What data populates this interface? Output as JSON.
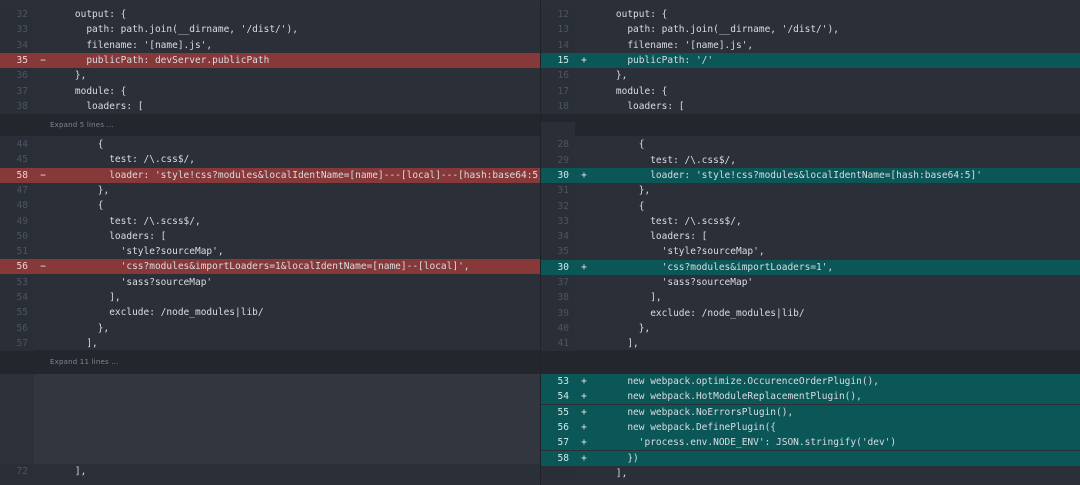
{
  "expand_labels": [
    "Expand 5 lines ...",
    "Expand 11 lines ..."
  ],
  "colors": {
    "deleted": "#873838",
    "added": "#0b5757",
    "background": "#2b2f38"
  },
  "left": {
    "block1": [
      {
        "ln": "32",
        "mk": "",
        "type": "ctx",
        "code": "    output: {"
      },
      {
        "ln": "33",
        "mk": "",
        "type": "ctx",
        "code": "      path: path.join(__dirname, '/dist/'),"
      },
      {
        "ln": "34",
        "mk": "",
        "type": "ctx",
        "code": "      filename: '[name].js',"
      },
      {
        "ln": "35",
        "mk": "−",
        "type": "del",
        "code": "      publicPath: devServer.publicPath"
      },
      {
        "ln": "36",
        "mk": "",
        "type": "ctx",
        "code": "    },"
      },
      {
        "ln": "37",
        "mk": "",
        "type": "ctx",
        "code": "    module: {"
      },
      {
        "ln": "38",
        "mk": "",
        "type": "ctx",
        "code": "      loaders: ["
      }
    ],
    "block2": [
      {
        "ln": "44",
        "mk": "",
        "type": "ctx",
        "code": "        {"
      },
      {
        "ln": "45",
        "mk": "",
        "type": "ctx",
        "code": "          test: /\\.css$/,"
      },
      {
        "ln": "58",
        "mk": "−",
        "type": "del",
        "code": "          loader: 'style!css?modules&localIdentName=[name]---[local]---[hash:base64:5]'"
      },
      {
        "ln": "47",
        "mk": "",
        "type": "ctx",
        "code": "        },"
      },
      {
        "ln": "48",
        "mk": "",
        "type": "ctx",
        "code": "        {"
      },
      {
        "ln": "49",
        "mk": "",
        "type": "ctx",
        "code": "          test: /\\.scss$/,"
      },
      {
        "ln": "50",
        "mk": "",
        "type": "ctx",
        "code": "          loaders: ["
      },
      {
        "ln": "51",
        "mk": "",
        "type": "ctx",
        "code": "            'style?sourceMap',"
      },
      {
        "ln": "56",
        "mk": "−",
        "type": "del",
        "code": "            'css?modules&importLoaders=1&localIdentName=[name]--[local]',"
      },
      {
        "ln": "53",
        "mk": "",
        "type": "ctx",
        "code": "            'sass?sourceMap'"
      },
      {
        "ln": "54",
        "mk": "",
        "type": "ctx",
        "code": "          ],"
      },
      {
        "ln": "55",
        "mk": "",
        "type": "ctx",
        "code": "          exclude: /node_modules|lib/"
      },
      {
        "ln": "56",
        "mk": "",
        "type": "ctx",
        "code": "        },"
      },
      {
        "ln": "57",
        "mk": "",
        "type": "ctx",
        "code": "      ],"
      }
    ],
    "block3_tail": [
      {
        "ln": "72",
        "mk": "",
        "type": "ctx",
        "code": "    ],"
      }
    ]
  },
  "right": {
    "block1": [
      {
        "ln": "12",
        "mk": "",
        "type": "ctx",
        "code": "    output: {"
      },
      {
        "ln": "13",
        "mk": "",
        "type": "ctx",
        "code": "      path: path.join(__dirname, '/dist/'),"
      },
      {
        "ln": "14",
        "mk": "",
        "type": "ctx",
        "code": "      filename: '[name].js',"
      },
      {
        "ln": "15",
        "mk": "+",
        "type": "add",
        "code": "      publicPath: '/'"
      },
      {
        "ln": "16",
        "mk": "",
        "type": "ctx",
        "code": "    },"
      },
      {
        "ln": "17",
        "mk": "",
        "type": "ctx",
        "code": "    module: {"
      },
      {
        "ln": "18",
        "mk": "",
        "type": "ctx",
        "code": "      loaders: ["
      }
    ],
    "block2": [
      {
        "ln": "",
        "mk": "",
        "type": "ctx",
        "code": ""
      },
      {
        "ln": "28",
        "mk": "",
        "type": "ctx",
        "code": "        {"
      },
      {
        "ln": "29",
        "mk": "",
        "type": "ctx",
        "code": "          test: /\\.css$/,"
      },
      {
        "ln": "30",
        "mk": "+",
        "type": "add",
        "code": "          loader: 'style!css?modules&localIdentName=[hash:base64:5]'"
      },
      {
        "ln": "31",
        "mk": "",
        "type": "ctx",
        "code": "        },"
      },
      {
        "ln": "32",
        "mk": "",
        "type": "ctx",
        "code": "        {"
      },
      {
        "ln": "33",
        "mk": "",
        "type": "ctx",
        "code": "          test: /\\.scss$/,"
      },
      {
        "ln": "34",
        "mk": "",
        "type": "ctx",
        "code": "          loaders: ["
      },
      {
        "ln": "35",
        "mk": "",
        "type": "ctx",
        "code": "            'style?sourceMap',"
      },
      {
        "ln": "30",
        "mk": "+",
        "type": "add",
        "code": "            'css?modules&importLoaders=1',"
      },
      {
        "ln": "37",
        "mk": "",
        "type": "ctx",
        "code": "            'sass?sourceMap'"
      },
      {
        "ln": "38",
        "mk": "",
        "type": "ctx",
        "code": "          ],"
      },
      {
        "ln": "39",
        "mk": "",
        "type": "ctx",
        "code": "          exclude: /node_modules|lib/"
      },
      {
        "ln": "40",
        "mk": "",
        "type": "ctx",
        "code": "        },"
      },
      {
        "ln": "41",
        "mk": "",
        "type": "ctx",
        "code": "      ],"
      }
    ],
    "block3": [
      {
        "ln": "53",
        "mk": "+",
        "type": "add",
        "code": "      new webpack.optimize.OccurenceOrderPlugin(),"
      },
      {
        "ln": "54",
        "mk": "+",
        "type": "add",
        "code": "      new webpack.HotModuleReplacementPlugin(),"
      },
      {
        "ln": "55",
        "mk": "+",
        "type": "add",
        "code": "      new webpack.NoErrorsPlugin(),"
      },
      {
        "ln": "56",
        "mk": "+",
        "type": "add",
        "code": "      new webpack.DefinePlugin({"
      },
      {
        "ln": "57",
        "mk": "+",
        "type": "add",
        "code": "        'process.env.NODE_ENV': JSON.stringify('dev')"
      },
      {
        "ln": "58",
        "mk": "+",
        "type": "add",
        "code": "      })"
      },
      {
        "ln": "",
        "mk": "",
        "type": "ctx",
        "code": "    ],"
      }
    ]
  }
}
